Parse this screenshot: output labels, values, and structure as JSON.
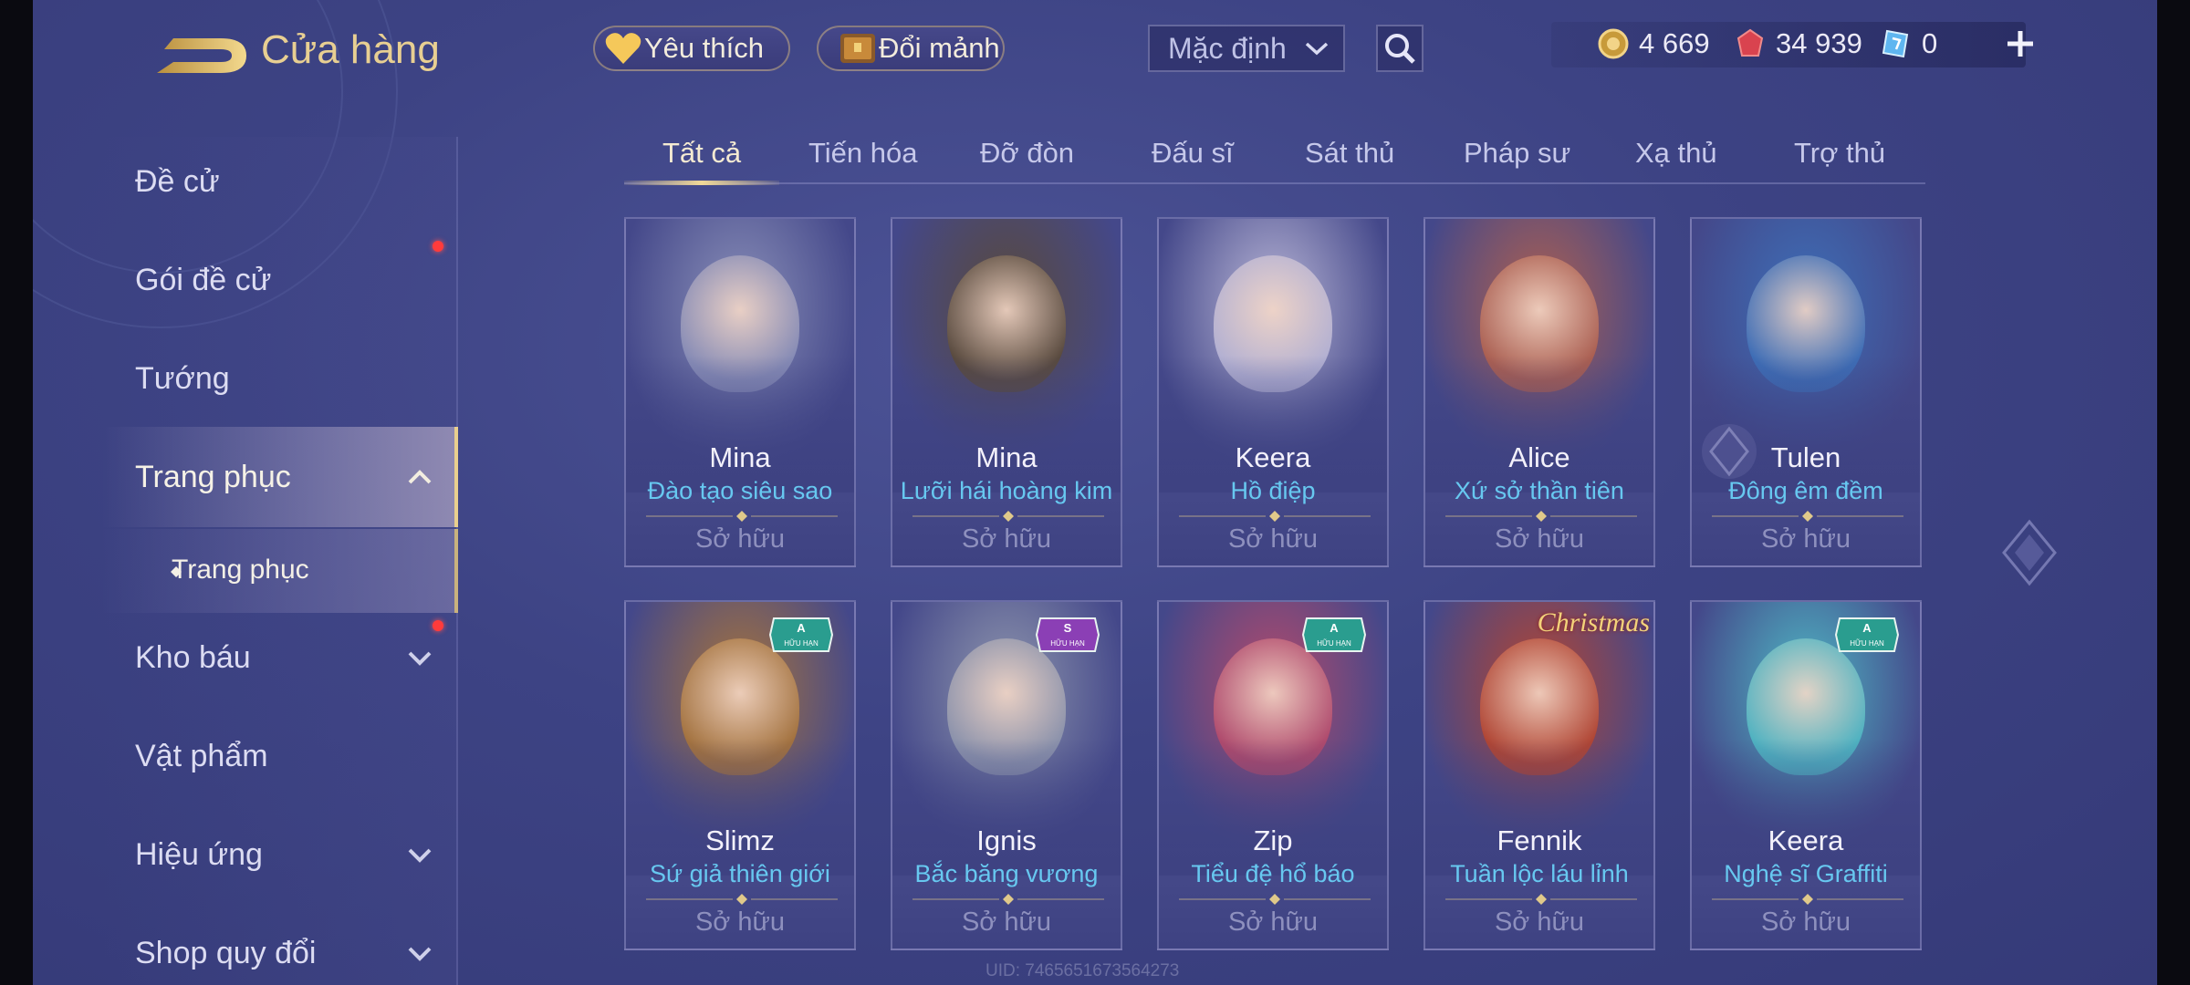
{
  "header": {
    "title": "Cửa hàng",
    "favorite_label": "Yêu thích",
    "fragment_label": "Đổi mảnh",
    "sort_value": "Mặc định",
    "currencies": [
      {
        "icon": "gold-coin-icon",
        "value": "4 669"
      },
      {
        "icon": "ruby-voucher-icon",
        "value": "34 939"
      },
      {
        "icon": "blue-ticket-icon",
        "value": "0"
      }
    ]
  },
  "sidebar": {
    "items": [
      {
        "label": "Đề cử"
      },
      {
        "label": "Gói đề cử"
      },
      {
        "label": "Tướng"
      },
      {
        "label": "Trang phục"
      },
      {
        "label": "Trang phục"
      },
      {
        "label": "Kho báu"
      },
      {
        "label": "Vật phẩm"
      },
      {
        "label": "Hiệu ứng"
      },
      {
        "label": "Shop quy đổi"
      }
    ]
  },
  "tabs": [
    {
      "label": "Tất cả"
    },
    {
      "label": "Tiến hóa"
    },
    {
      "label": "Đỡ đòn"
    },
    {
      "label": "Đấu sĩ"
    },
    {
      "label": "Sát thủ"
    },
    {
      "label": "Pháp sư"
    },
    {
      "label": "Xạ thủ"
    },
    {
      "label": "Trợ thủ"
    }
  ],
  "skins": [
    {
      "hero": "Mina",
      "skin": "Đào tạo siêu sao",
      "status": "Sở hữu",
      "theme": "#8a8fb8"
    },
    {
      "hero": "Mina",
      "skin": "Lưỡi hái hoàng kim",
      "status": "Sở hữu",
      "theme": "#5a4a3a"
    },
    {
      "hero": "Keera",
      "skin": "Hồ điệp",
      "status": "Sở hữu",
      "theme": "#b9b6d6"
    },
    {
      "hero": "Alice",
      "skin": "Xứ sở thần tiên",
      "status": "Sở hữu",
      "theme": "#b0604e"
    },
    {
      "hero": "Tulen",
      "skin": "Đông êm đềm",
      "status": "Sở hữu",
      "theme": "#3d6fb8"
    },
    {
      "hero": "Slimz",
      "skin": "Sứ giả thiên giới",
      "status": "Sở hữu",
      "theme": "#a8743a",
      "badge_rank": "A",
      "badge_text": "HỮU HẠN",
      "badge_color": "#2a9d8f"
    },
    {
      "hero": "Ignis",
      "skin": "Bắc băng vương",
      "status": "Sở hữu",
      "theme": "#8f96ad",
      "badge_rank": "S",
      "badge_text": "HỮU HẠN",
      "badge_color": "#8b3fb5"
    },
    {
      "hero": "Zip",
      "skin": "Tiểu đệ hổ báo",
      "status": "Sở hữu",
      "theme": "#b54a6b",
      "badge_rank": "A",
      "badge_text": "HỮU HẠN",
      "badge_color": "#2a9d8f"
    },
    {
      "hero": "Fennik",
      "skin": "Tuần lộc láu lỉnh",
      "status": "Sở hữu",
      "theme": "#b6452f",
      "banner": "Christmas"
    },
    {
      "hero": "Keera",
      "skin": "Nghệ sĩ Graffiti",
      "status": "Sở hữu",
      "theme": "#4fb8c4",
      "badge_rank": "A",
      "badge_text": "HỮU HẠN",
      "badge_color": "#2a9d8f"
    }
  ],
  "uid_text": "UID: 7465651673564273",
  "colors": {
    "accent_gold": "#e8cf92",
    "skin_name": "#67c8f0",
    "owned": "#8e90be"
  }
}
